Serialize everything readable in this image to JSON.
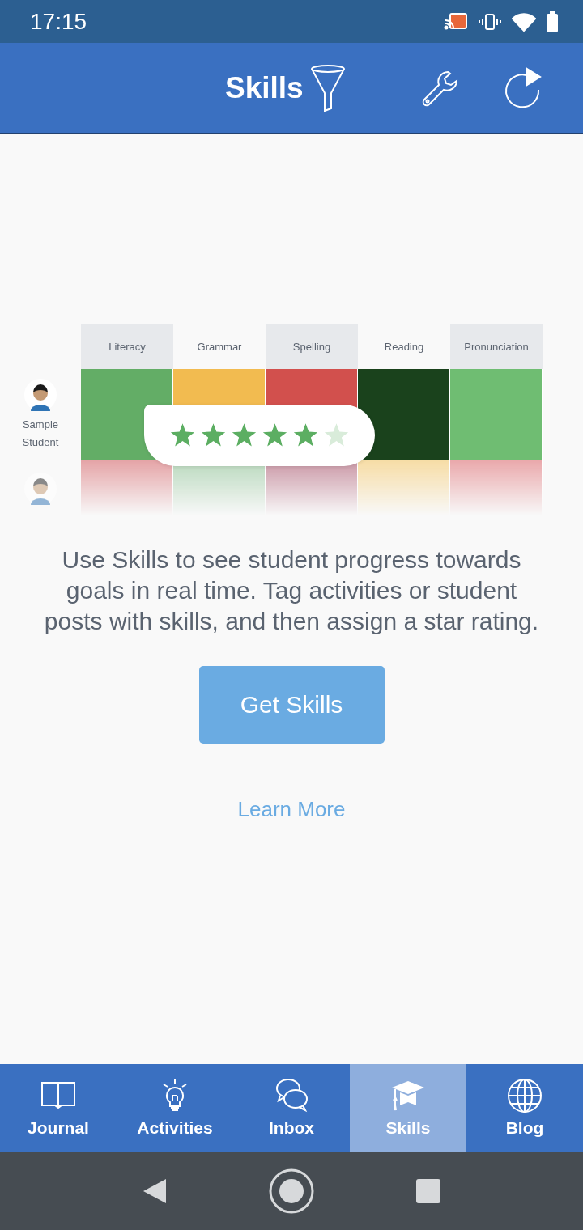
{
  "status_bar": {
    "time": "17:15"
  },
  "header": {
    "title": "Skills"
  },
  "illustration": {
    "columns": [
      "Literacy",
      "Grammar",
      "Spelling",
      "Reading",
      "Pronunciation"
    ],
    "rows": [
      {
        "label": "Sample Student",
        "cells": [
          {
            "color": "#63ad66"
          },
          {
            "color": "#f2bb50"
          },
          {
            "color": "#d2504d"
          },
          {
            "color": "#1a421c"
          },
          {
            "color": "#6fbd72"
          }
        ]
      },
      {
        "cells": [
          {
            "color": "#e4a2a5"
          },
          {
            "color": "#b8d8bc"
          },
          {
            "color": "#c995a4"
          },
          {
            "color": "#f6dca4"
          },
          {
            "color": "#e9a7aa"
          }
        ]
      }
    ],
    "rating": {
      "stars": 5
    }
  },
  "description": "Use Skills to see student progress towards goals in real time. Tag activities or student posts with skills, and then assign a star rating.",
  "primary_button": "Get Skills",
  "link": "Learn More",
  "bottom_nav": [
    {
      "kind": "book",
      "label": "Journal",
      "selected": false
    },
    {
      "kind": "bulb",
      "label": "Activities",
      "selected": false
    },
    {
      "kind": "chat",
      "label": "Inbox",
      "selected": false
    },
    {
      "kind": "cap",
      "label": "Skills",
      "selected": true
    },
    {
      "kind": "globe",
      "label": "Blog",
      "selected": false
    }
  ]
}
